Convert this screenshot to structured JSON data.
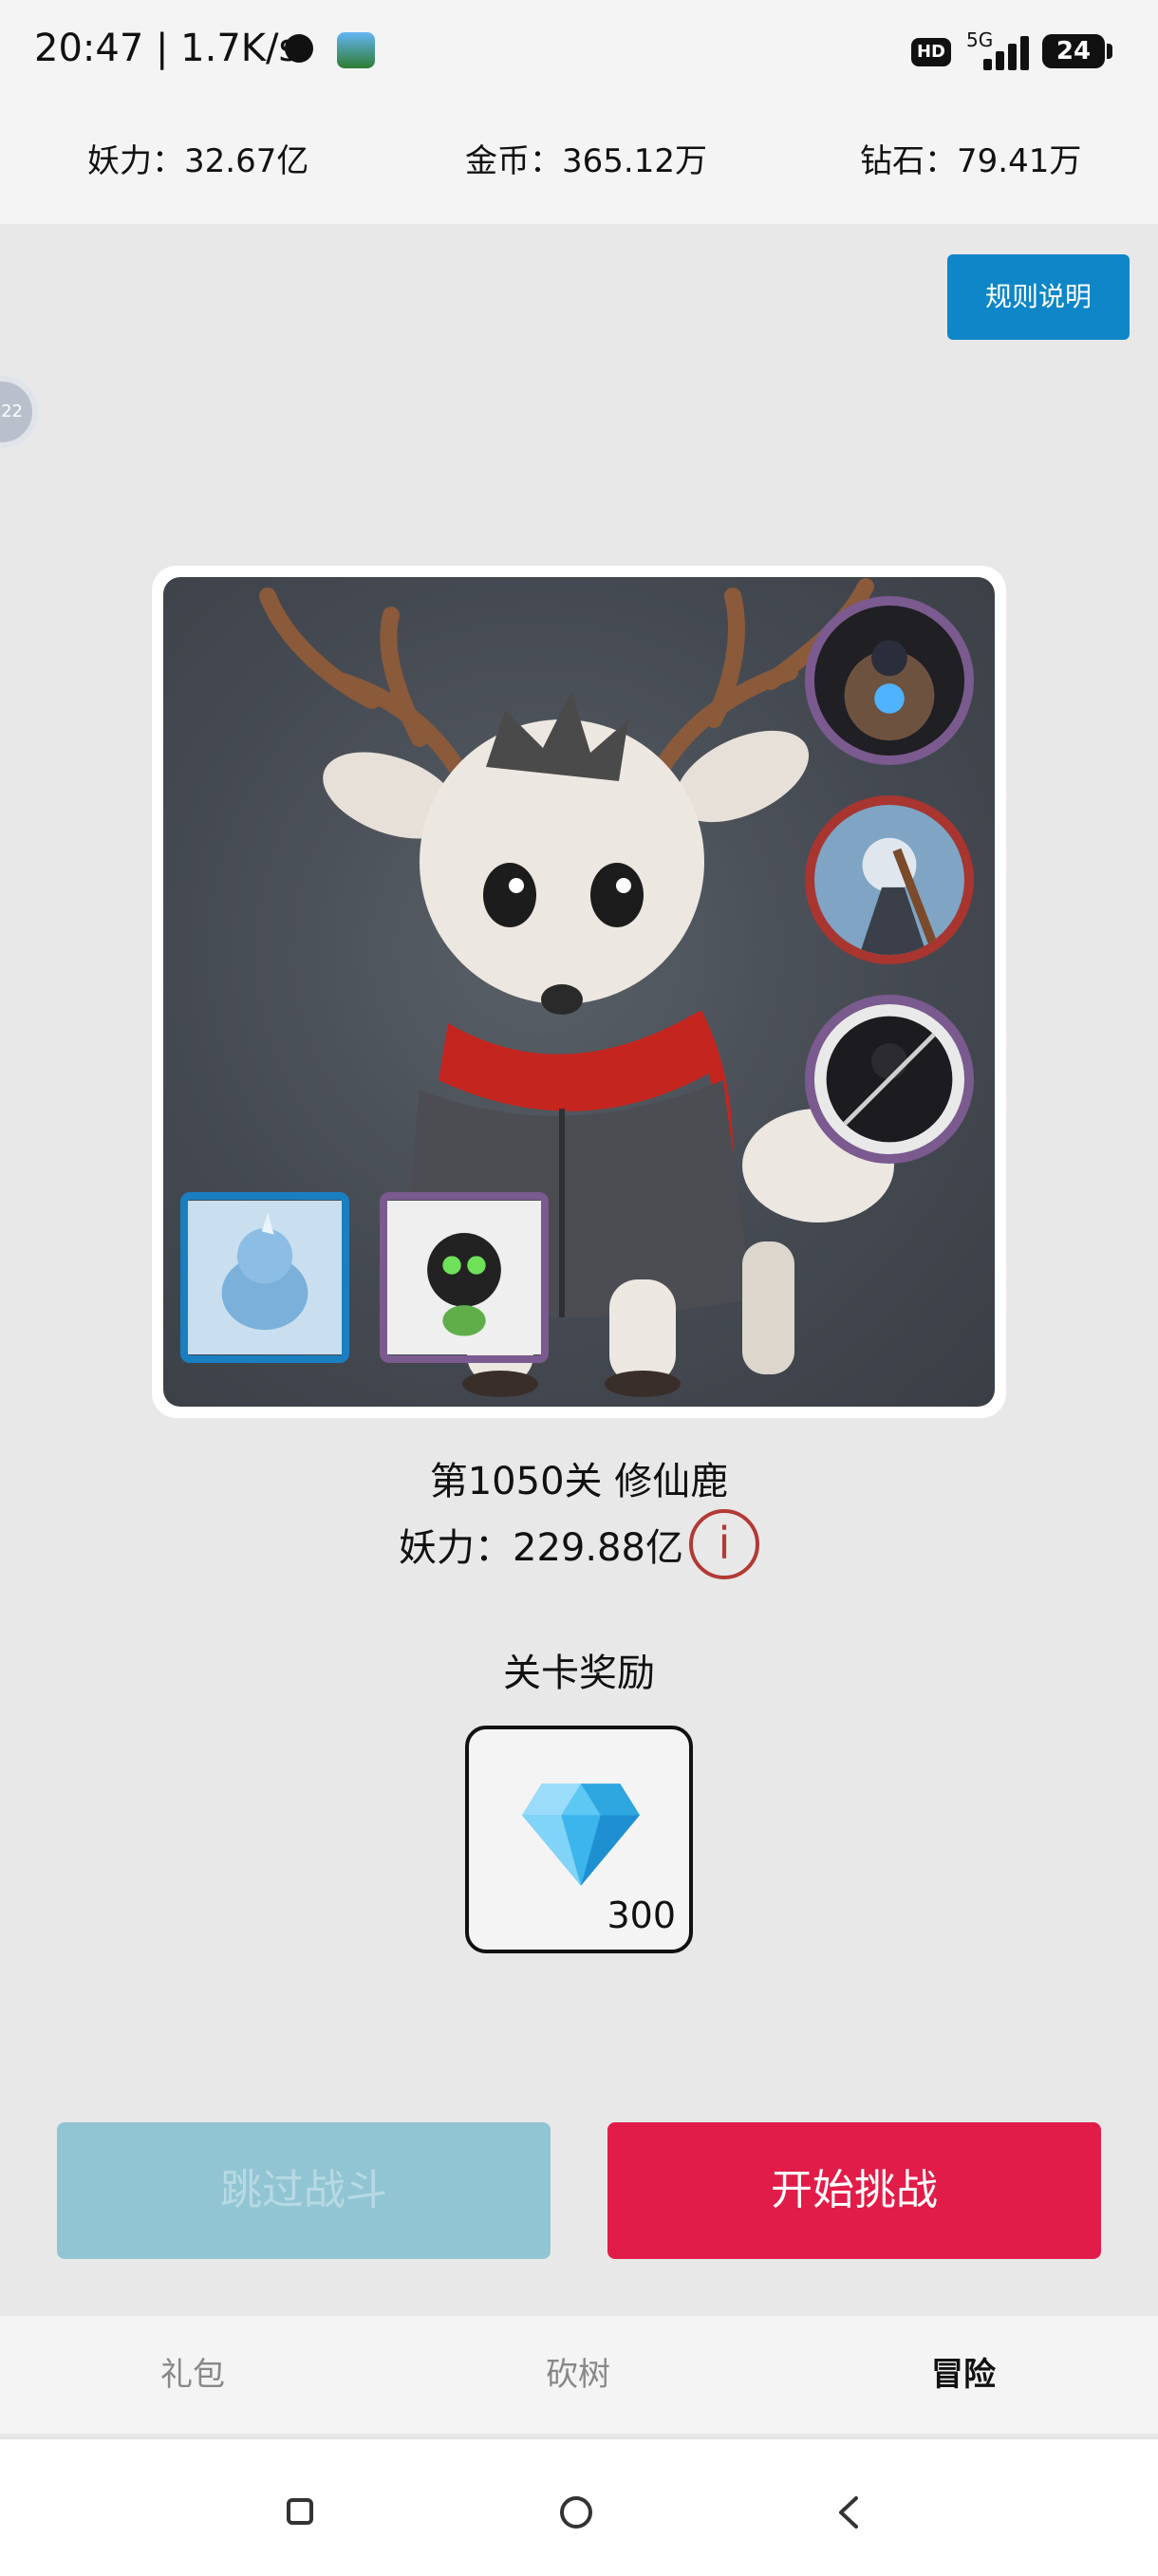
{
  "status_bar": {
    "time_net": "20:47 | 1.7K/s",
    "hd": "HD",
    "network": "5G",
    "battery": "24"
  },
  "resources": {
    "power": "妖力：32.67亿",
    "gold": "金币：365.12万",
    "diamond": "钻石：79.41万"
  },
  "rules_button": "规则说明",
  "floating_avatar_text": "22",
  "stage": {
    "title": "第1050关 修仙鹿",
    "power": "妖力：229.88亿",
    "info_symbol": "i"
  },
  "reward": {
    "title": "关卡奖励",
    "item_icon": "diamond-icon",
    "count": "300"
  },
  "buttons": {
    "skip": "跳过战斗",
    "start": "开始挑战"
  },
  "bottom_nav": {
    "items": [
      "礼包",
      "砍树",
      "冒险"
    ],
    "active": "冒险"
  },
  "colors": {
    "accent_blue": "#0e86c8",
    "start_red": "#e21c48",
    "skip_disabled": "#91c5d3",
    "info_red": "#b23a35"
  }
}
